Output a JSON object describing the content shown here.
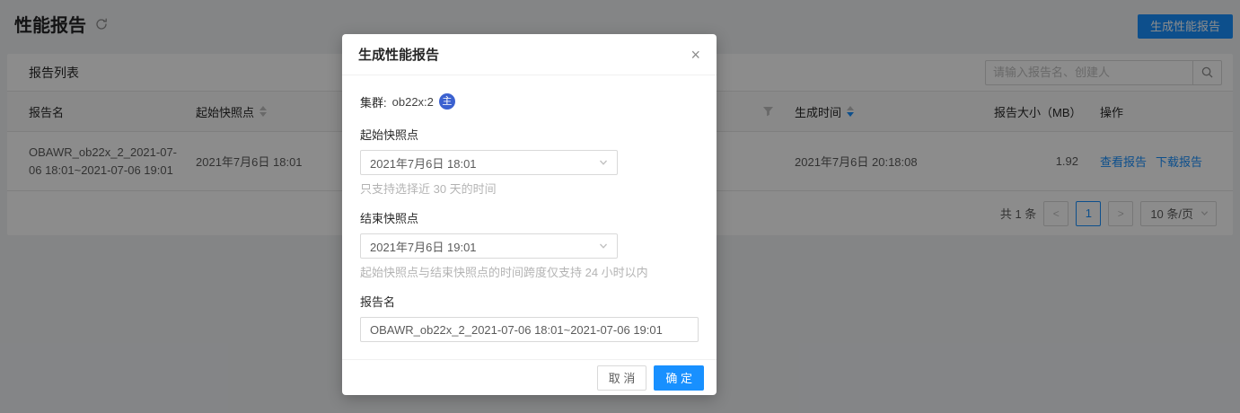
{
  "colors": {
    "primary": "#1890ff",
    "badge_blue": "#3b61d0",
    "mask": "rgba(0,0,0,0.45)",
    "card_bg": "#ffffff",
    "page_bg": "#f0f2f5"
  },
  "page": {
    "title": "性能报告",
    "generate_button": "生成性能报告"
  },
  "report_list": {
    "card_title": "报告列表",
    "search": {
      "placeholder": "请输入报告名、创建人"
    },
    "columns": {
      "name": "报告名",
      "start_snapshot": "起始快照点",
      "obscured": "",
      "generated_at": "生成时间",
      "size": "报告大小（MB）",
      "actions": "操作"
    },
    "rows": [
      {
        "name": "OBAWR_ob22x_2_2021-07-06 18:01~2021-07-06 19:01",
        "start_snapshot": "2021年7月6日 18:01",
        "generated_at": "2021年7月6日 20:18:08",
        "size": "1.92",
        "view_action": "查看报告",
        "download_action": "下载报告"
      }
    ],
    "pagination": {
      "total": "共 1 条",
      "prev": "<",
      "current": "1",
      "next": ">",
      "page_size": "10 条/页"
    }
  },
  "modal": {
    "title": "生成性能报告",
    "close_glyph": "×",
    "cluster": {
      "label": "集群:",
      "value": "ob22x:2",
      "badge": "主"
    },
    "start_snapshot": {
      "label": "起始快照点",
      "value": "2021年7月6日 18:01",
      "hint": "只支持选择近 30 天的时间"
    },
    "end_snapshot": {
      "label": "结束快照点",
      "value": "2021年7月6日 19:01",
      "hint": "起始快照点与结束快照点的时间跨度仅支持 24 小时以内"
    },
    "report_name": {
      "label": "报告名",
      "value": "OBAWR_ob22x_2_2021-07-06 18:01~2021-07-06 19:01"
    },
    "cancel_button": "取 消",
    "ok_button": "确 定"
  }
}
